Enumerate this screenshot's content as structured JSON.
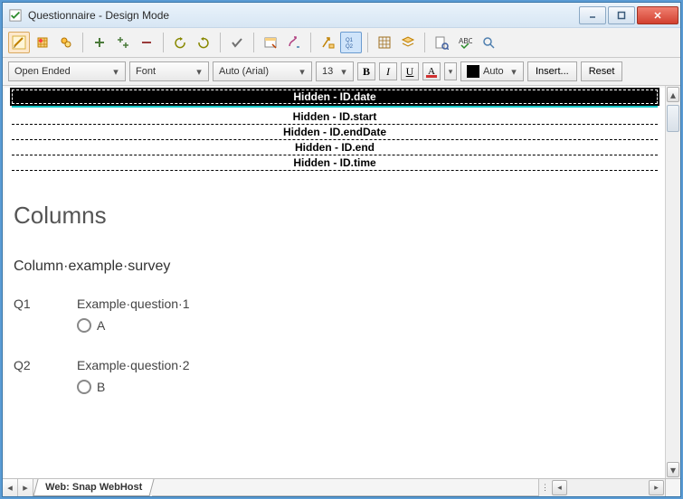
{
  "window": {
    "title": "Questionnaire - Design Mode"
  },
  "toolbar2": {
    "style": "Open Ended",
    "font_label": "Font",
    "font_name": "Auto (Arial)",
    "font_size": "13",
    "color_auto": "Auto",
    "insert_btn": "Insert...",
    "reset_btn": "Reset"
  },
  "hidden": [
    "Hidden - ID.date",
    "Hidden - ID.start",
    "Hidden - ID.endDate",
    "Hidden - ID.end",
    "Hidden - ID.time"
  ],
  "survey": {
    "heading": "Columns",
    "subtitle": "Column·example·survey",
    "questions": [
      {
        "num": "Q1",
        "text": "Example·question·1",
        "option": "A"
      },
      {
        "num": "Q2",
        "text": "Example·question·2",
        "option": "B"
      }
    ]
  },
  "tabs": {
    "active": "Web: Snap WebHost"
  },
  "format_labels": {
    "bold": "B",
    "italic": "I",
    "underline": "U"
  }
}
